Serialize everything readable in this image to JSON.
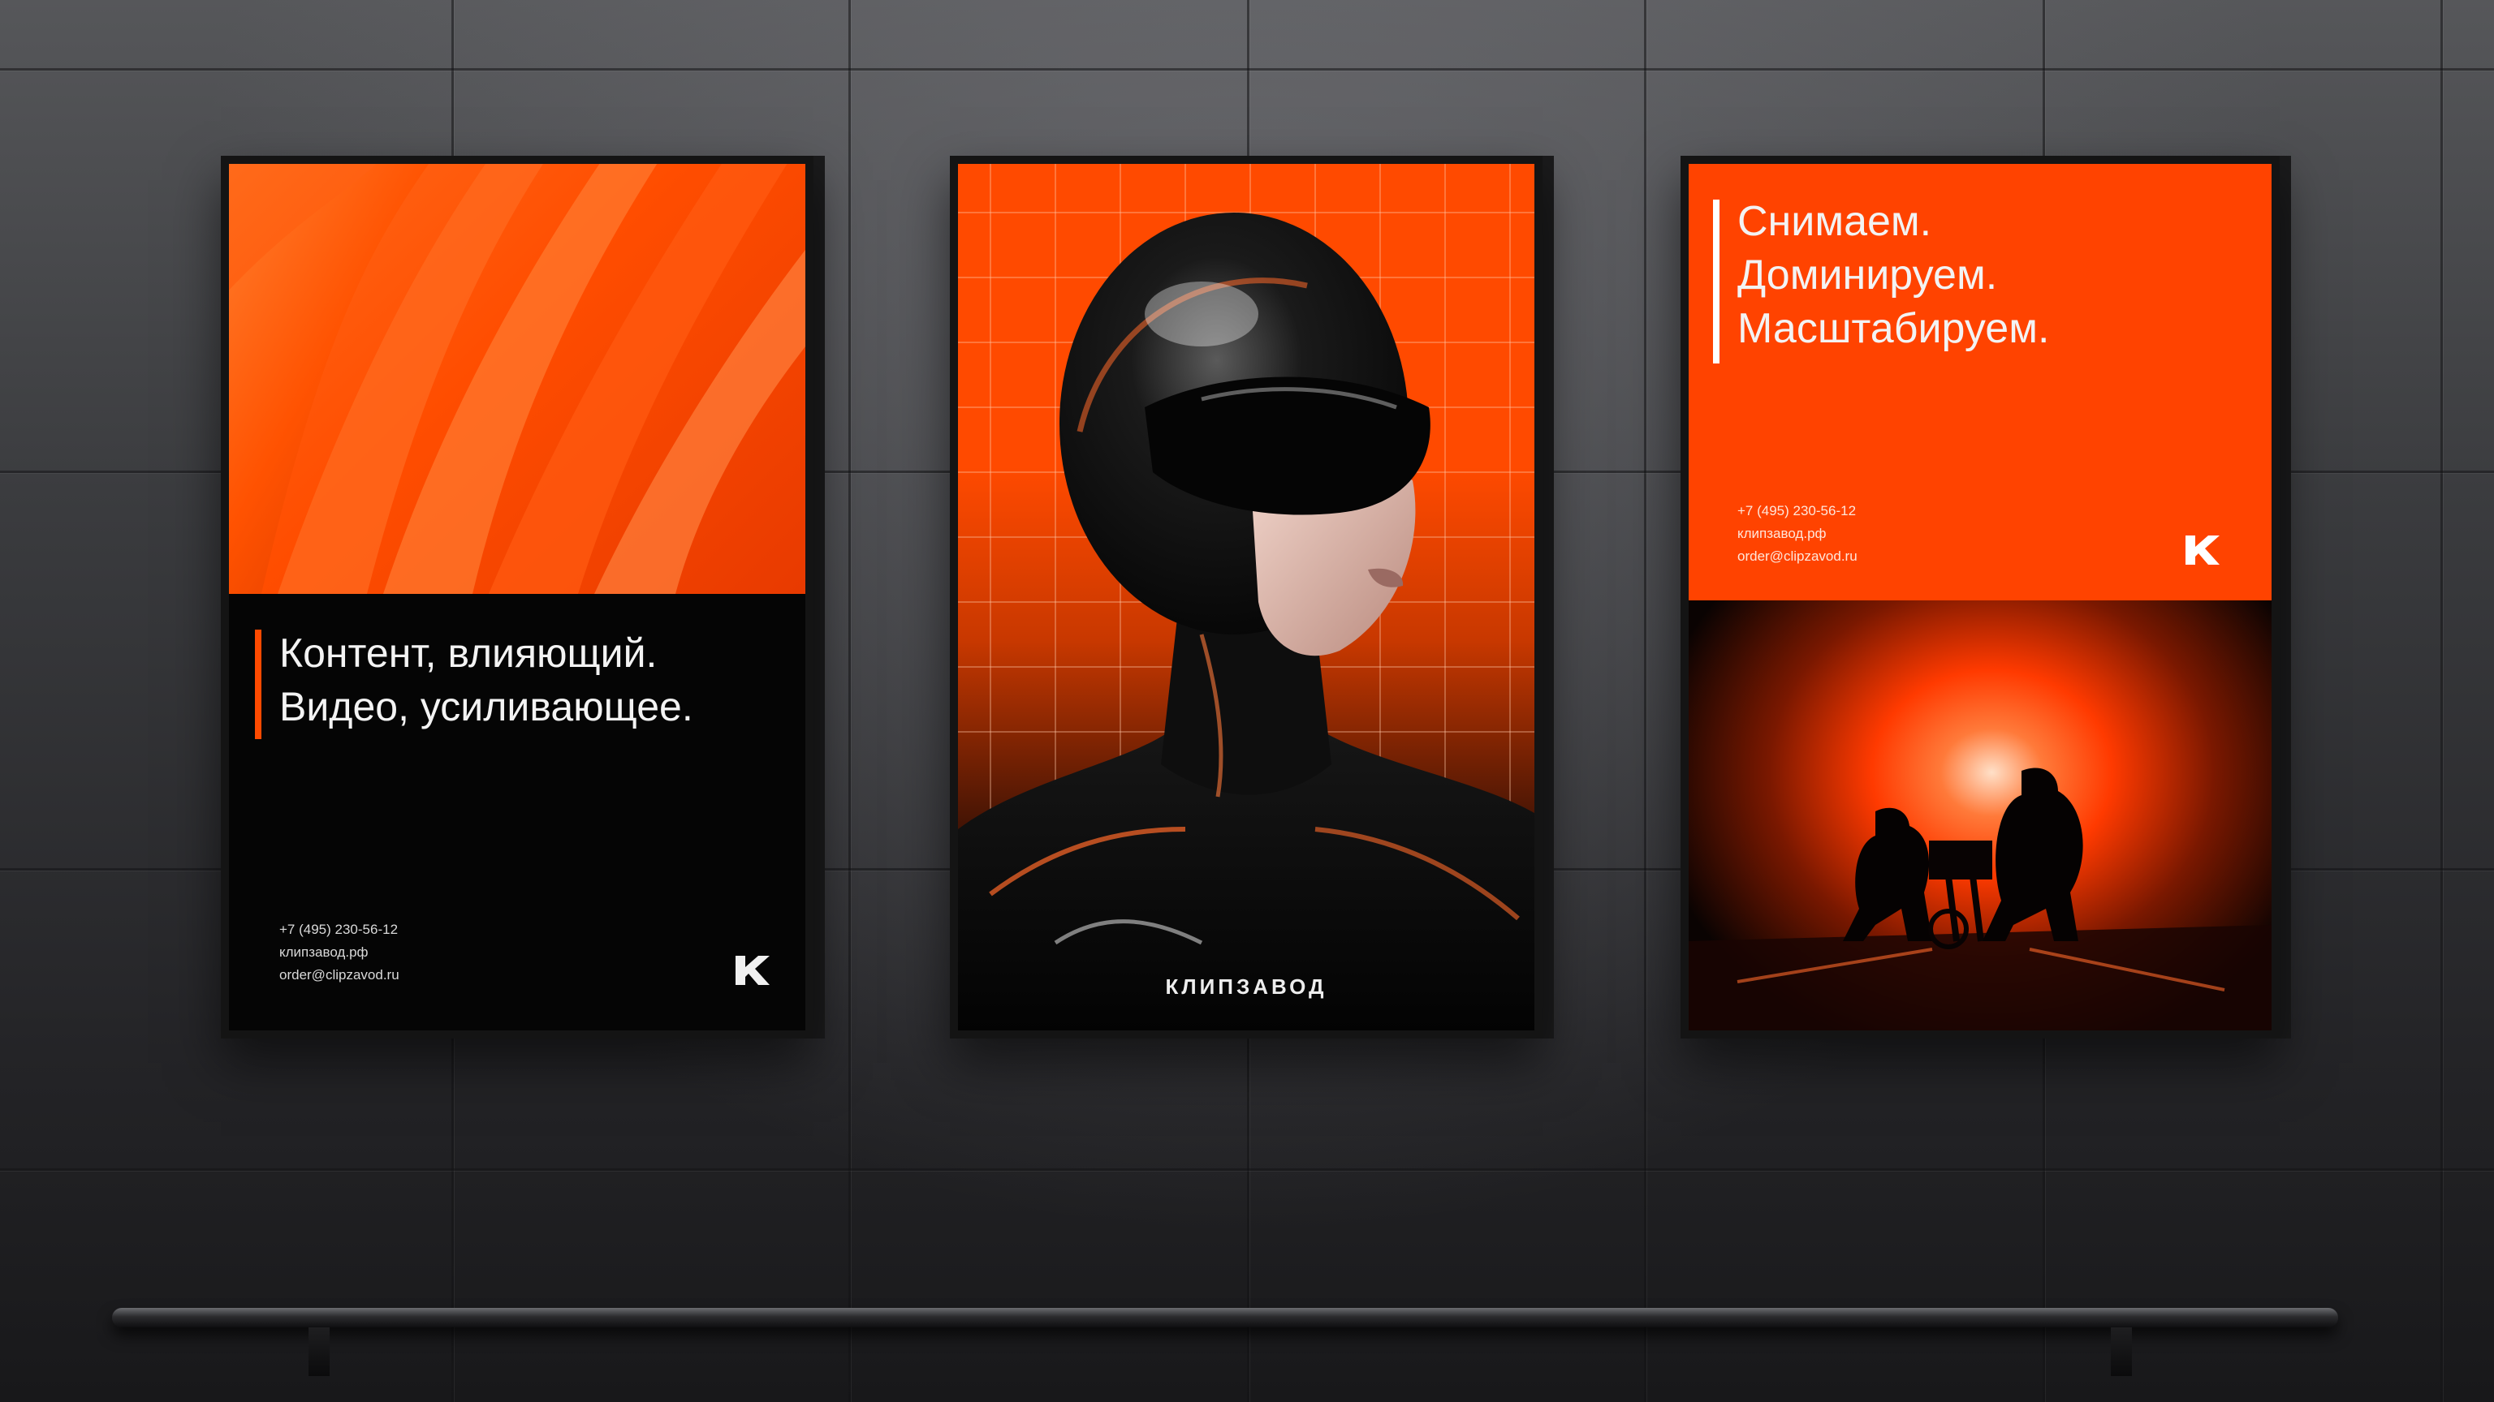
{
  "scene": {
    "description_colors": {
      "accent": "#ff4a00",
      "wall": "#3b3c3f",
      "dark": "#050505"
    }
  },
  "poster_left": {
    "headline_line1": "Контент, влияющий.",
    "headline_line2": "Видео, усиливающее.",
    "phone": "+7 (495) 230-56-12",
    "site": "клипзавод.рф",
    "email": "order@clipzavod.ru",
    "logo_icon": "k-logo-icon"
  },
  "poster_mid": {
    "brand": "КЛИПЗАВОД",
    "image_icon": "chrome-helmet-figure"
  },
  "poster_right": {
    "headline_line1": "Снимаем.",
    "headline_line2": "Доминируем.",
    "headline_line3": "Масштабируем.",
    "phone": "+7 (495) 230-56-12",
    "site": "клипзавод.рф",
    "email": "order@clipzavod.ru",
    "logo_icon": "k-logo-icon",
    "image_icon": "film-crew-silhouette"
  }
}
